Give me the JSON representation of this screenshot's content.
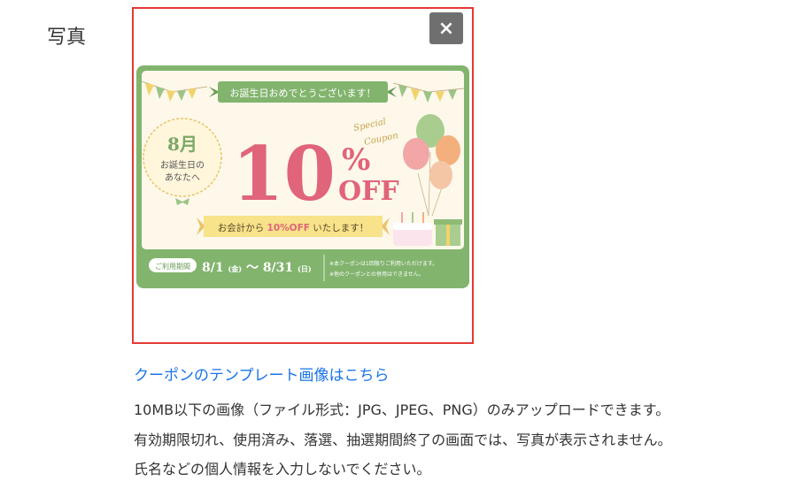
{
  "field": {
    "label": "写真"
  },
  "photo": {
    "close_label": "×",
    "coupon": {
      "banner": "お誕生日おめでとうございます！",
      "month": "8月",
      "badge_line1": "お誕生日の",
      "badge_line2": "あなたへ",
      "discount_number": "10",
      "percent": "%",
      "off": "OFF",
      "special": "Special",
      "coupon_word": "Coupon",
      "ribbon_pre": "お会計から",
      "ribbon_highlight": "10%OFF",
      "ribbon_post": "いたします！",
      "period_tag": "ご利用期間",
      "period_start": "8/1",
      "period_start_day": "(金)",
      "period_sep": "～",
      "period_end": "8/31",
      "period_end_day": "(日)",
      "note1": "※本クーポンは1回限りご利用いただけます。",
      "note2": "※他のクーポンとの併用はできません。",
      "colors": {
        "green": "#82b46e",
        "pink": "#e0647a",
        "cream": "#fdf8ea",
        "yellow": "#f8e28a"
      }
    }
  },
  "template_link": "クーポンのテンプレート画像はこちら",
  "notes": [
    "10MB以下の画像（ファイル形式：JPG、JPEG、PNG）のみアップロードできます。",
    "有効期限切れ、使用済み、落選、抽選期間終了の画面では、写真が表示されません。",
    "氏名などの個人情報を入力しないでください。"
  ]
}
